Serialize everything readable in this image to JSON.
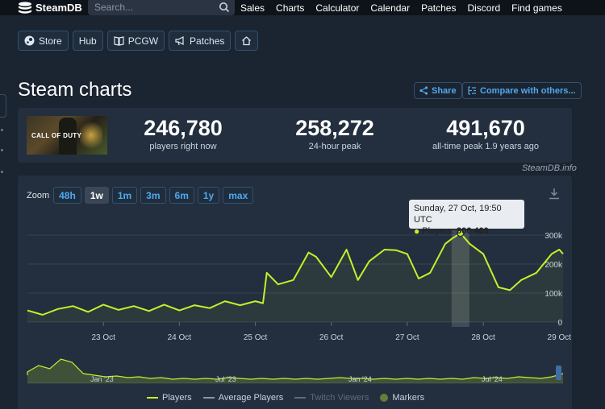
{
  "brand": {
    "name": "SteamDB"
  },
  "search": {
    "placeholder": "Search..."
  },
  "nav": [
    "Sales",
    "Charts",
    "Calculator",
    "Calendar",
    "Patches",
    "Discord",
    "Find games"
  ],
  "app_buttons": [
    {
      "label": "Store",
      "icon": "steam-icon"
    },
    {
      "label": "Hub",
      "icon": ""
    },
    {
      "label": "PCGW",
      "icon": "book-icon"
    },
    {
      "label": "Patches",
      "icon": "megaphone-icon"
    },
    {
      "label": "",
      "icon": "home-icon"
    }
  ],
  "page": {
    "title": "Steam charts",
    "share_label": "Share",
    "compare_label": "Compare with others...",
    "watermark": "SteamDB.info"
  },
  "game": {
    "logo_text": "CALL OF DUTY"
  },
  "stats": [
    {
      "value": "246,780",
      "label": "players right now"
    },
    {
      "value": "258,272",
      "label": "24-hour peak"
    },
    {
      "value": "491,670",
      "label": "all-time peak 1.9 years ago"
    }
  ],
  "zoom": {
    "label": "Zoom",
    "options": [
      "48h",
      "1w",
      "1m",
      "3m",
      "6m",
      "1y",
      "max"
    ],
    "active": "1w"
  },
  "tooltip": {
    "date": "Sunday, 27 Oct, 19:50 UTC",
    "series_label": "Players:",
    "value": "306 460"
  },
  "legend": [
    "Players",
    "Average Players",
    "Twitch Viewers",
    "Markers"
  ],
  "navigator_labels": [
    "Jan '23",
    "Jul '23",
    "Jan '24",
    "Jul '24"
  ],
  "colors": {
    "players": "#c6ef2b",
    "accent": "#4fa9ee",
    "background": "#1b2431",
    "panel": "#232f3e"
  },
  "chart_data": {
    "type": "line",
    "x_ticks": [
      "23 Oct",
      "24 Oct",
      "25 Oct",
      "26 Oct",
      "27 Oct",
      "28 Oct",
      "29 Oct"
    ],
    "y_ticks": [
      "0",
      "100k",
      "200k",
      "300k"
    ],
    "ylim": [
      0,
      300000
    ],
    "series": [
      {
        "name": "Players",
        "x": [
          22.0,
          22.2,
          22.4,
          22.6,
          22.8,
          23.0,
          23.2,
          23.4,
          23.6,
          23.8,
          24.0,
          24.2,
          24.4,
          24.6,
          24.8,
          25.0,
          25.1,
          25.15,
          25.3,
          25.5,
          25.7,
          25.8,
          26.0,
          26.2,
          26.35,
          26.5,
          26.7,
          26.85,
          27.0,
          27.15,
          27.3,
          27.5,
          27.6,
          27.7,
          27.82,
          28.0,
          28.2,
          28.35,
          28.5,
          28.7,
          28.9,
          29.0,
          29.05
        ],
        "values": [
          40000,
          25000,
          45000,
          55000,
          35000,
          60000,
          42000,
          55000,
          38000,
          60000,
          40000,
          58000,
          48000,
          72000,
          58000,
          72000,
          65000,
          170000,
          130000,
          145000,
          240000,
          225000,
          155000,
          250000,
          145000,
          210000,
          250000,
          248000,
          235000,
          150000,
          170000,
          270000,
          290000,
          306460,
          270000,
          235000,
          120000,
          110000,
          145000,
          170000,
          235000,
          250000,
          235000
        ]
      }
    ],
    "highlight": {
      "x": 27.7,
      "value": 306460
    }
  }
}
